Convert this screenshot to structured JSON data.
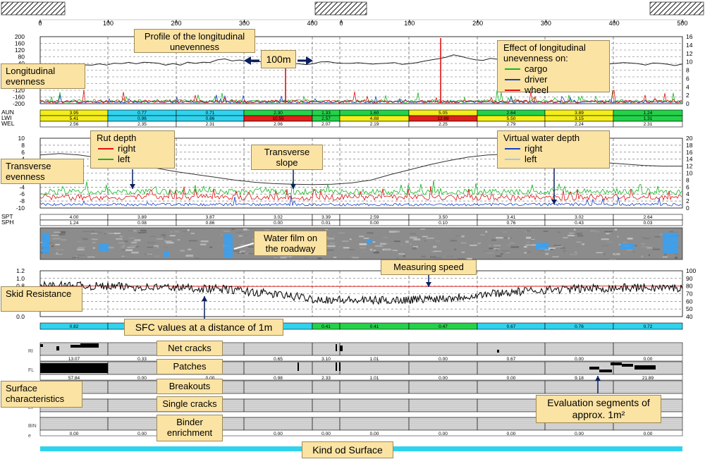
{
  "callouts": {
    "profile": "Profile of the longitudinal unevenness",
    "distance": "100m",
    "longitudinal_evenness": "Longitudinal evenness",
    "effect_title": "Effect of longitudinal unevenness on:",
    "effect_items": [
      "cargo",
      "driver",
      "wheel"
    ],
    "rut_title": "Rut depth",
    "rut_items": [
      "right",
      "left"
    ],
    "transverse_slope": "Transverse slope",
    "water_title": "Virtual water depth",
    "water_items": [
      "right",
      "left"
    ],
    "transverse_evenness": "Transverse evenness",
    "water_film": "Water film on the roadway",
    "measuring_speed": "Measuring speed",
    "skid_resistance": "Skid Resistance",
    "sfc_values": "SFC values at a distance of 1m",
    "net_cracks": "Net cracks",
    "patches": "Patches",
    "breakouts": "Breakouts",
    "single_cracks": "Single cracks",
    "binder": "Binder enrichment",
    "surface_characteristics": "Surface characteristics",
    "evaluation_segments": "Evaluation segments of approx. 1m²",
    "kind_of_surface": "Kind od Surface"
  },
  "colors": {
    "callout_bg": "#fbe3a3",
    "cyan": "#2fd3ee",
    "green": "#24d24a",
    "yellow": "#f3ee1a",
    "red": "#e0201a",
    "series_red": "#e01010",
    "series_green": "#10b820",
    "series_blue": "#1840c8",
    "water": "#3aa0f0"
  },
  "chart_data": [
    {
      "type": "line",
      "name": "longitudinal-evenness",
      "x_axis_top_ticks_a": [
        "0",
        "100",
        "200",
        "300",
        "400"
      ],
      "x_axis_top_ticks_b": [
        "0",
        "100",
        "200",
        "300",
        "400",
        "500"
      ],
      "left_ticks": [
        "200",
        "160",
        "120",
        "80",
        "40",
        "0",
        "-40",
        "-80",
        "-120",
        "-160",
        "-200"
      ],
      "right_ticks": [
        "16",
        "14",
        "12",
        "10",
        "8",
        "6",
        "4",
        "2",
        "0"
      ],
      "left_range": [
        -200,
        200
      ],
      "right_range": [
        0,
        16
      ],
      "profile_y": [
        30,
        22,
        30,
        18,
        27,
        24,
        33,
        28,
        36,
        30,
        40,
        38,
        44,
        40,
        48,
        44,
        40,
        34,
        38,
        30,
        44,
        38,
        50,
        46,
        58,
        66,
        54,
        60,
        50,
        46,
        52,
        40,
        44,
        46,
        42,
        40,
        34,
        40,
        46,
        50,
        42,
        38,
        44,
        46,
        40,
        36,
        40,
        44,
        42,
        38,
        40,
        46,
        52,
        58,
        68,
        80,
        92,
        84,
        72,
        62,
        60,
        70,
        64,
        52,
        50,
        56,
        60,
        58,
        48,
        44,
        46,
        50,
        44,
        48,
        52,
        46,
        36,
        38,
        42,
        46,
        40,
        36,
        34,
        40,
        44,
        36,
        30,
        40
      ],
      "spike_x": [
        405,
        625
      ],
      "rows": [
        {
          "label": "AUN",
          "values": [
            "3.95",
            "0.77",
            "0.71",
            "2.30",
            "1.33",
            "1.60",
            "5.05",
            "2.64",
            "3.89",
            "1.24"
          ],
          "colors": [
            "yellow",
            "cyan",
            "cyan",
            "green",
            "green",
            "green",
            "yellow",
            "green",
            "yellow",
            "green"
          ]
        },
        {
          "label": "LWI",
          "values": [
            "5.41",
            "0.96",
            "0.86",
            "10.55",
            "2.57",
            "4.88",
            "12.88",
            "5.50",
            "3.15",
            "1.31"
          ],
          "colors": [
            "yellow",
            "cyan",
            "cyan",
            "red",
            "green",
            "yellow",
            "red",
            "yellow",
            "yellow",
            "green"
          ]
        },
        {
          "label": "WEL",
          "values": [
            "2.56",
            "2.35",
            "2.31",
            "2.06",
            "2.07",
            "2.19",
            "2.25",
            "2.79",
            "2.24",
            "2.31"
          ],
          "colors": []
        }
      ]
    },
    {
      "type": "line",
      "name": "transverse-evenness",
      "left_ticks": [
        "10",
        "8",
        "6",
        "4",
        "2",
        "0",
        "-2",
        "-4",
        "-6",
        "-8",
        "-10"
      ],
      "right_ticks": [
        "20",
        "18",
        "16",
        "14",
        "12",
        "10",
        "8",
        "6",
        "4",
        "2",
        "0"
      ],
      "left_range": [
        -10,
        10
      ],
      "right_range": [
        0,
        20
      ],
      "slope_y": [
        15.2,
        15.6,
        15.2,
        14.4,
        13.6,
        12.6,
        11.4,
        10.4,
        9.6,
        8.8,
        8.0,
        7.4,
        7.0,
        6.8,
        6.7,
        6.8,
        7.2,
        8.0,
        9.6,
        11.0,
        12.4,
        13.6,
        14.6,
        15.2,
        15.4,
        15.2,
        14.8,
        14.2,
        13.6,
        13.0,
        12.6,
        12.2,
        12.0,
        12.0
      ],
      "rows": [
        {
          "label": "SPT",
          "values": [
            "4.00",
            "3.89",
            "3.87",
            "3.02",
            "3.39",
            "2.59",
            "3.50",
            "3.41",
            "3.02",
            "2.64"
          ]
        },
        {
          "label": "SPH",
          "values": [
            "1.24",
            "0.08",
            "0.86",
            "0.00",
            "0.01",
            "0.00",
            "0.10",
            "0.76",
            "0.43",
            "0.03"
          ]
        }
      ]
    },
    {
      "type": "line",
      "name": "skid-resistance",
      "left_ticks": [
        "1.2",
        "1.0",
        "0.8",
        "0.6",
        "0.4",
        "0.2",
        "0.0"
      ],
      "right_ticks": [
        "100",
        "90",
        "80",
        "70",
        "60",
        "50",
        "40"
      ],
      "left_range": [
        0,
        1.2
      ],
      "right_range": [
        40,
        100
      ],
      "speed_y": [
        0.8,
        0.8,
        0.79,
        0.79,
        0.79,
        0.79,
        0.8,
        0.8
      ],
      "rows": [
        {
          "label": "",
          "values": [
            "0.82",
            "",
            "",
            "",
            "0.41",
            "0.41",
            "0.47",
            "0.67",
            "0.76",
            "0.72"
          ],
          "colors": [
            "cyan",
            "cyan",
            "cyan",
            "cyan",
            "green",
            "green",
            "green",
            "cyan",
            "cyan",
            "cyan"
          ]
        }
      ]
    },
    {
      "type": "table",
      "name": "surface-characteristics",
      "rows": [
        {
          "label": "RI",
          "values": [
            "13.07",
            "0.33",
            "",
            "0.65",
            "3.10",
            "1.01",
            "0.00",
            "0.67",
            "0.00",
            "0.00"
          ]
        },
        {
          "label": "FL",
          "values": [
            "57.84",
            "0.00",
            "0.00",
            "0.98",
            "2.33",
            "1.01",
            "0.00",
            "0.00",
            "9.18",
            "21.89"
          ]
        },
        {
          "label": "AB",
          "values": [
            "",
            "",
            "",
            "",
            "",
            "",
            "",
            "",
            "",
            ""
          ]
        },
        {
          "label": "EI",
          "values": [
            "",
            "",
            "",
            "",
            "",
            "",
            "",
            "",
            "",
            ""
          ]
        },
        {
          "label": "BIN",
          "values": [
            "0.00",
            "0.00",
            "0.00",
            "0.00",
            "0.00",
            "0.00",
            "0.00",
            "0.00",
            "0.00",
            "0.00"
          ]
        }
      ]
    }
  ]
}
